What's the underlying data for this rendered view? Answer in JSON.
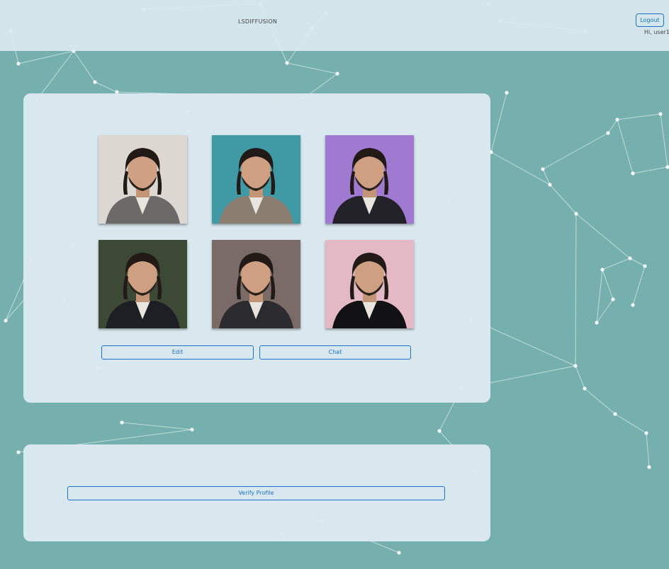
{
  "header": {
    "brand": "LSDIFFUSION",
    "logout_label": "Logout",
    "greeting": "Hi, user1"
  },
  "gallery": {
    "photos": [
      {
        "label": "portrait-1",
        "bg": "#ddd7d2",
        "suit": "#6b6a68"
      },
      {
        "label": "portrait-2",
        "bg": "#3f9aa6",
        "suit": "#8a7e70"
      },
      {
        "label": "portrait-3",
        "bg": "#a07ad0",
        "suit": "#232229"
      },
      {
        "label": "portrait-4",
        "bg": "#3c4a35",
        "suit": "#1d1f24"
      },
      {
        "label": "portrait-5",
        "bg": "#7a6b66",
        "suit": "#2b2b30"
      },
      {
        "label": "portrait-6",
        "bg": "#e2b9c4",
        "suit": "#121214"
      }
    ],
    "edit_label": "Edit",
    "chat_label": "Chat"
  },
  "verify": {
    "button_label": "Verify Profile"
  },
  "colors": {
    "background": "#76b0ae",
    "panel": "#dce9f0",
    "accent": "#1a73c9"
  }
}
